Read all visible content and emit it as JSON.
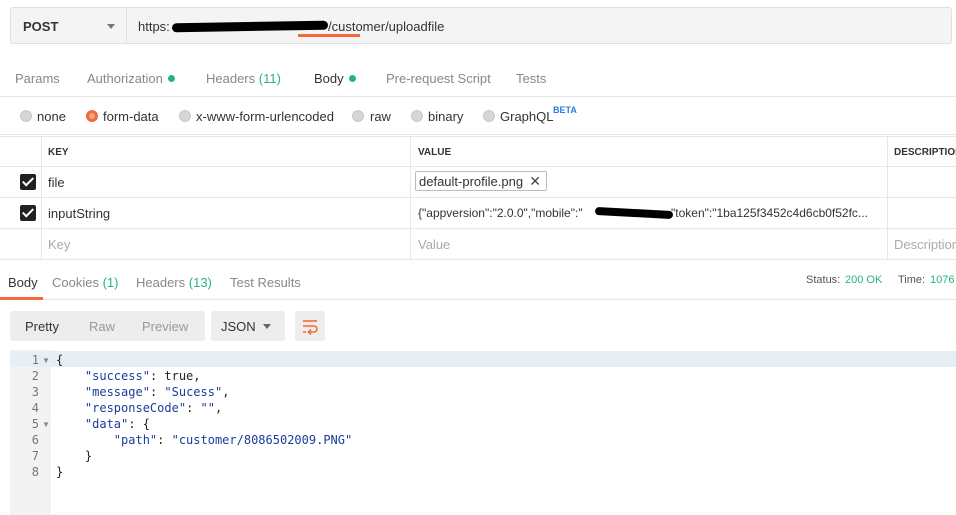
{
  "request": {
    "method": "POST",
    "url_prefix": "https:",
    "url_suffix": "/customer/uploadfile"
  },
  "request_tabs": [
    {
      "label": "Params"
    },
    {
      "label": "Authorization"
    },
    {
      "label": "Headers",
      "count": "(11)"
    },
    {
      "label": "Body"
    },
    {
      "label": "Pre-request Script"
    },
    {
      "label": "Tests"
    }
  ],
  "body_types": [
    {
      "label": "none",
      "selected": false
    },
    {
      "label": "form-data",
      "selected": true
    },
    {
      "label": "x-www-form-urlencoded",
      "selected": false
    },
    {
      "label": "raw",
      "selected": false
    },
    {
      "label": "binary",
      "selected": false
    },
    {
      "label": "GraphQL",
      "selected": false
    }
  ],
  "graphql_badge": "BETA",
  "params": {
    "headers": {
      "key": "KEY",
      "value": "VALUE",
      "description": "DESCRIPTION"
    },
    "rows": [
      {
        "checked": true,
        "key": "file",
        "value": "default-profile.png"
      },
      {
        "checked": true,
        "key": "inputString",
        "value_prefix": "{\"appversion\":\"2.0.0\",\"mobile\":\"",
        "value_suffix": "\"token\":\"1ba125f3452c4d6cb0f52fc..."
      }
    ],
    "placeholders": {
      "key": "Key",
      "value": "Value",
      "description": "Description"
    }
  },
  "response_tabs": [
    {
      "label": "Body"
    },
    {
      "label": "Cookies",
      "count": "(1)"
    },
    {
      "label": "Headers",
      "count": "(13)"
    },
    {
      "label": "Test Results"
    }
  ],
  "status": {
    "status_label": "Status:",
    "status_value": "200 OK",
    "time_label": "Time:",
    "time_value": "1076"
  },
  "view_modes": [
    "Pretty",
    "Raw",
    "Preview"
  ],
  "format": "JSON",
  "code_lines": [
    {
      "n": "1",
      "text": "{"
    },
    {
      "n": "2",
      "text": "    \"success\": true,"
    },
    {
      "n": "3",
      "text": "    \"message\": \"Sucess\","
    },
    {
      "n": "4",
      "text": "    \"responseCode\": \"\","
    },
    {
      "n": "5",
      "text": "    \"data\": {"
    },
    {
      "n": "6",
      "text": "        \"path\": \"customer/8086502009.PNG\""
    },
    {
      "n": "7",
      "text": "    }"
    },
    {
      "n": "8",
      "text": "}"
    }
  ],
  "colors": {
    "accent": "#f26b3a",
    "success": "#26b47f",
    "beta": "#2a7ae2"
  }
}
